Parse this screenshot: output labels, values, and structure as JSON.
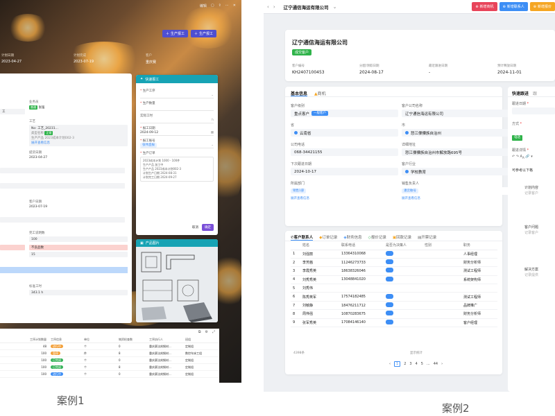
{
  "case1": {
    "top_action": "编辑",
    "header_buttons": [
      "生产报工",
      "生产报工"
    ],
    "meta": [
      {
        "label": "计划日期",
        "value": "2023-04-27"
      },
      {
        "label": "计划完成",
        "value": "2023-07-19"
      },
      {
        "label": "客户",
        "value": "重庆赛"
      }
    ],
    "main": {
      "salesman_label": "业务员",
      "salesman_tag": "普通",
      "salesman_name": "张强",
      "left_value": "工",
      "process_label": "工艺",
      "process_value": "No: 工艺_20231...",
      "process_sub1_label": "类型名称",
      "process_sub1_tag": "正常",
      "process_sub2_label": "生产产品",
      "process_sub2_value": "2023成本计划002-3",
      "process_link": "展开查看信息",
      "order_date_label": "提货日期",
      "order_date_value": "2023-04-27",
      "customer_date_label": "客户日期",
      "customer_date_value": "2023-07-19",
      "completed_label": "完工说明数",
      "completed_value": "100",
      "bad_label": "不良品数",
      "bad_value": "15",
      "hours_label": "标准工时",
      "hours_value": "343.1 h"
    },
    "quick": {
      "title": "快速报工",
      "fields": [
        {
          "label": "生产工序",
          "value": ""
        },
        {
          "label": "生产数量",
          "value": ""
        },
        {
          "label": "实际工时",
          "value": ""
        },
        {
          "label": "报工日期",
          "value": "2024-09-12"
        },
        {
          "label": "报工账号",
          "value": "张伟直报"
        }
      ],
      "order_label": "生产订单",
      "order_lines": [
        "2023成本计划 1000 - 100件",
        "生产产品   加工中",
        "生产产品   2023成本计划002-3",
        "计划生产日期  2024-08-31",
        "计划完工日期  2024-09-27"
      ],
      "cancel": "取消",
      "confirm": "确定"
    },
    "product": {
      "title": "产品图片"
    },
    "table": {
      "headers": [
        "工序计划数量",
        "工序信息",
        "单位",
        "物资检查数",
        "工序执行人",
        "班组"
      ],
      "rows": [
        {
          "qty": "48",
          "status": "进行中",
          "unit": "个",
          "chk": "0",
          "person": "重庆赛法刻钢材...",
          "team": "定制组"
        },
        {
          "qty": "100",
          "status": "暂停",
          "unit": "件",
          "chk": "8",
          "person": "重庆赛法刻钢材...",
          "team": "数控车床工组"
        },
        {
          "qty": "100",
          "status": "已完成",
          "unit": "个",
          "chk": "0",
          "person": "重庆赛法刻钢材...",
          "team": "定制组"
        },
        {
          "qty": "100",
          "status": "已完成",
          "unit": "个",
          "chk": "8",
          "person": "重庆赛法刻钢材...",
          "team": "定制组"
        },
        {
          "qty": "100",
          "status": "进行中",
          "unit": "个",
          "chk": "0",
          "person": "重庆赛法刻钢材...",
          "team": "定制组"
        }
      ]
    },
    "caption": "案例1"
  },
  "case2": {
    "nav": {
      "title": "辽宁通信海运有限公司",
      "buttons": [
        {
          "label": "新增商机",
          "color": "#e8445a"
        },
        {
          "label": "新增联系人",
          "color": "#3d8ef5"
        },
        {
          "label": "新增报价",
          "color": "#f5a623"
        }
      ]
    },
    "summary": {
      "name": "辽宁通信海运有限公司",
      "badge": "成交客户",
      "meta": [
        {
          "label": "客户编号",
          "value": "KH2407100453"
        },
        {
          "label": "分配/领取日期",
          "value": "2024-08-17"
        },
        {
          "label": "最近跟进日期",
          "value": "-"
        },
        {
          "label": "预计释放日期",
          "value": "2024-11-01"
        }
      ]
    },
    "info": {
      "tabs": [
        "基本信息",
        "商机"
      ],
      "fields": [
        {
          "label": "客户级别",
          "value": "重点客户",
          "tag": "一般客户"
        },
        {
          "label": "客户公司名称",
          "value": "辽宁通信海运有限公司"
        },
        {
          "label": "省",
          "value": "云南省"
        },
        {
          "label": "市",
          "value": "怒江傈僳族自治州"
        },
        {
          "label": "公司电话",
          "value": "068-34421155"
        },
        {
          "label": "详细地址",
          "value": "怒江傈僳族自治州市解放路695号"
        },
        {
          "label": "下次跟进日期",
          "value": "2024-10-17"
        },
        {
          "label": "客户行业",
          "value": "学校教育"
        },
        {
          "label": "所属部门",
          "value": "销售1部"
        },
        {
          "label": "销售负责人",
          "value": "潘云敏号"
        }
      ],
      "more_link": "展开查看信息"
    },
    "follow": {
      "tabs": [
        "快速跟进",
        "跟"
      ],
      "date_label": "跟进日期",
      "method_label": "方式",
      "method_tag": "电话",
      "detail_label": "跟进详情",
      "hint": "可参考以下格",
      "sections": [
        {
          "title": "计划内容",
          "sub": "记录客户"
        },
        {
          "title": "客户问题",
          "sub": "记录客户"
        },
        {
          "title": "解决方案",
          "sub": "记录提供"
        }
      ]
    },
    "contacts": {
      "tabs": [
        "客户联系人",
        "订单记录",
        "财务信息",
        "报价记录",
        "回款记录",
        "开票记录"
      ],
      "headers": [
        "姓名",
        "联系电话",
        "是否为决策人",
        "性别",
        "职务"
      ],
      "rows": [
        {
          "name": "刘强丽",
          "phone": "13364310068",
          "gender": "",
          "title": "人事经理"
        },
        {
          "name": "李芳茜",
          "phone": "11246273733",
          "gender": "",
          "title": "财务分析师"
        },
        {
          "name": "李霞秀英",
          "phone": "18638326046",
          "gender": "",
          "title": "测试工程师"
        },
        {
          "name": "刘秀秀英",
          "phone": "13048841020",
          "gender": "",
          "title": "系统架构师"
        },
        {
          "name": "刘秀伟",
          "phone": "",
          "gender": "",
          "title": ""
        },
        {
          "name": "陈秀英军",
          "phone": "17574182485",
          "gender": "",
          "title": "测试工程师"
        },
        {
          "name": "刘敏静",
          "phone": "18476211712",
          "gender": "",
          "title": "品牌推广"
        },
        {
          "name": "周伟强",
          "phone": "10870283675",
          "gender": "",
          "title": "财务分析师"
        },
        {
          "name": "张军秀英",
          "phone": "17084146140",
          "gender": "",
          "title": "客户经理"
        }
      ],
      "footer": "4398条",
      "footer2": "显示统计",
      "pages": [
        "1",
        "2",
        "3",
        "4",
        "5",
        "...",
        "44"
      ]
    },
    "caption": "案例2"
  }
}
